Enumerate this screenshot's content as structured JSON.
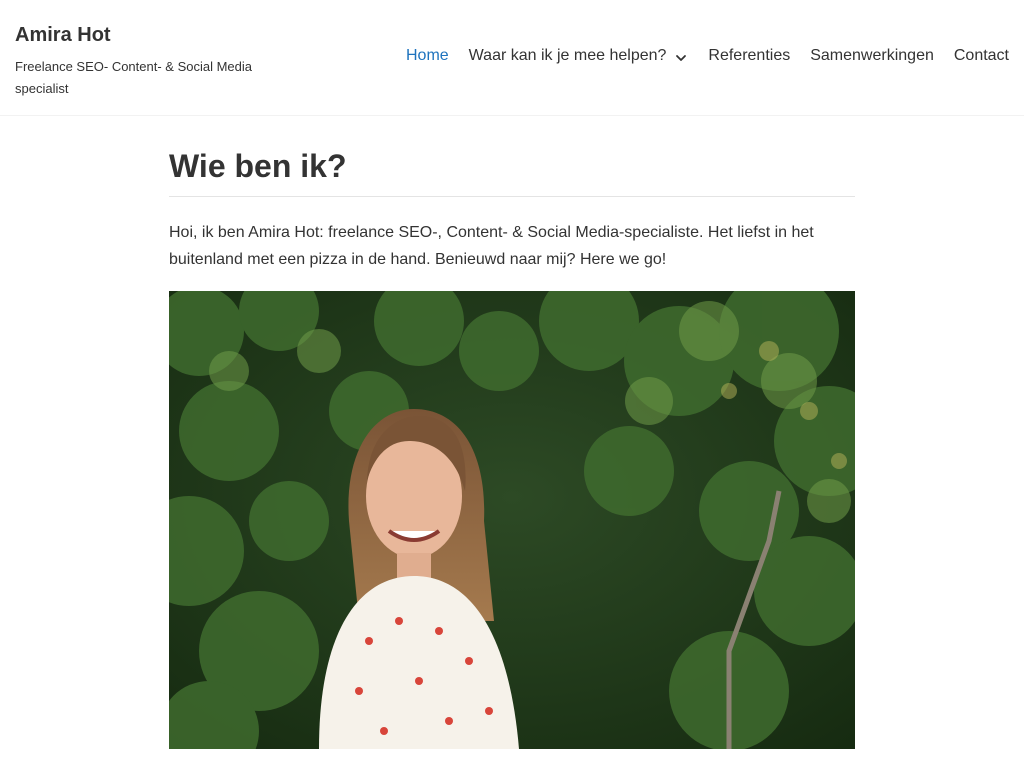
{
  "header": {
    "site_title": "Amira Hot",
    "tagline": "Freelance SEO- Content- & Social Media specialist"
  },
  "nav": {
    "items": [
      {
        "label": "Home",
        "active": true
      },
      {
        "label": "Waar kan ik je mee helpen?",
        "has_dropdown": true
      },
      {
        "label": "Referenties"
      },
      {
        "label": "Samenwerkingen"
      },
      {
        "label": "Contact"
      }
    ],
    "active_color": "#1e73be"
  },
  "main": {
    "title": "Wie ben ik?",
    "intro": "Hoi, ik ben Amira Hot: freelance SEO-, Content- & Social Media-specialiste. Het liefst in het buitenland met een pizza in de hand. Benieuwd naar mij? Here we go!"
  },
  "icons": {
    "dropdown": "chevron-down-icon"
  }
}
